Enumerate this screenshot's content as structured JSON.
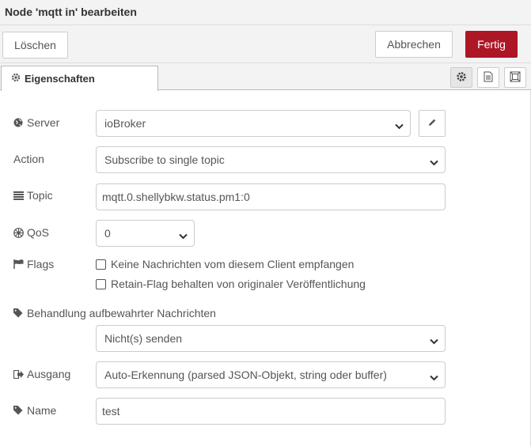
{
  "dialog": {
    "title": "Node 'mqtt in' bearbeiten"
  },
  "toolbar": {
    "delete_label": "Löschen",
    "cancel_label": "Abbrechen",
    "done_label": "Fertig",
    "done_color": "#ad1625"
  },
  "tabs": {
    "properties_label": "Eigenschaften",
    "icons": [
      "gear-icon",
      "description-icon",
      "appearance-icon"
    ]
  },
  "form": {
    "server": {
      "label": "Server",
      "value": "ioBroker",
      "icon": "globe-icon"
    },
    "action": {
      "label": "Action",
      "value": "Subscribe to single topic"
    },
    "topic": {
      "label": "Topic",
      "value": "mqtt.0.shellybkw.status.pm1:0",
      "icon": "tasks-icon"
    },
    "qos": {
      "label": "QoS",
      "value": "0",
      "icon": "empire-icon"
    },
    "flags": {
      "label": "Flags",
      "icon": "flag-icon",
      "no_local": "Keine Nachrichten vom diesem Client empfangen",
      "retain_as_published": "Retain-Flag behalten von originaler Veröffentlichung"
    },
    "retained": {
      "label": "Behandlung aufbewahrter Nachrichten",
      "value": "Nicht(s) senden",
      "icon": "tag-icon"
    },
    "output": {
      "label": "Ausgang",
      "value": "Auto-Erkennung (parsed JSON-Objekt, string oder buffer)",
      "icon": "sign-out-icon"
    },
    "name": {
      "label": "Name",
      "value": "test",
      "icon": "tag-icon"
    }
  }
}
